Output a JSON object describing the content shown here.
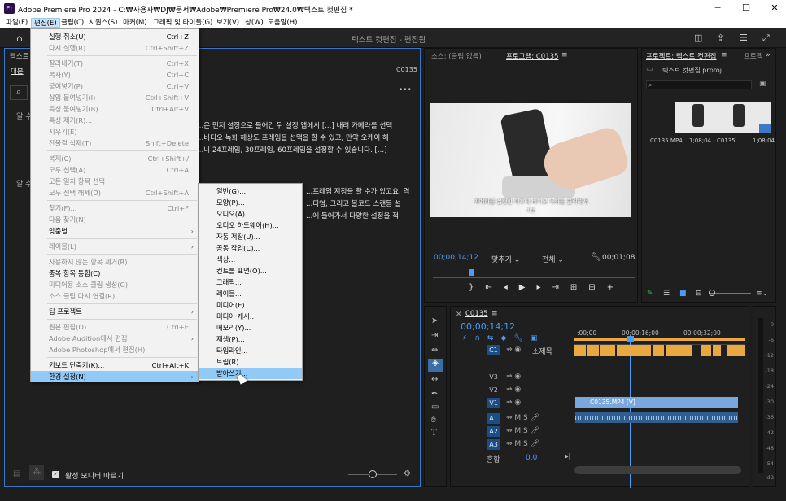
{
  "window": {
    "title": "Adobe Premiere Pro 2024 - C:₩사용자₩DJ₩문서₩Adobe₩Premiere Pro₩24.0₩텍스트 컷편집 *",
    "icon": "Pr",
    "minimize": "─",
    "maximize": "☐",
    "close": "✕"
  },
  "menubar": [
    "파일(F)",
    "편집(E)",
    "클립(C)",
    "시퀀스(S)",
    "마커(M)",
    "그래픽 및 타이틀(G)",
    "보기(V)",
    "창(W)",
    "도움말(H)"
  ],
  "toolbar": {
    "center_title": "텍스트 컷편집 - 편집됨"
  },
  "left_panel": {
    "tab": "텍스트",
    "subtab": "대본",
    "sequence": "C0135",
    "search_icon": "⌕",
    "more": "•••",
    "paragraphs": [
      "...은 먼저 설정으로 들어간 뒤 설정 앱에서 [...] 내려 카메라를 선택",
      "...비디오 녹화 해상도 프레임을 선택을 할 수 있고, 만약 오케이 해",
      "...니 24프레임, 30프레임, 60프레임을 설정할 수 있습니다. [...]",
      "...프레임 지정을 할 수가 있고요. 격",
      "...디엄, 그리고 볼코드 스캔등 설",
      "...에 들어가서 다양한 설정을 적"
    ],
    "speaker1": "알 수",
    "speaker2": "알 수",
    "footer_checkbox": "활성 모니터 따르기"
  },
  "source": {
    "tab1": "소스: (클립 없음)",
    "tab2": "프로그램: C0135",
    "menu": "≡",
    "subtitle": "카메라를 실행한 이후에 비디오 녹화를 클릭해서",
    "subtitle2": "기본",
    "timecode": "00;00;14;12",
    "fit": "맞추기",
    "quality": "전체",
    "duration": "00;01;08"
  },
  "project": {
    "tab1": "프로젝트: 텍스트 컷편집",
    "tab2": "프로젝",
    "menu": "≡",
    "more": "»",
    "file": "텍스트 컷편집.prproj",
    "items": [
      {
        "name": "C0135.MP4",
        "dur": "1;08;04"
      },
      {
        "name": "C0135",
        "dur": "1;08;04"
      }
    ]
  },
  "timeline": {
    "seq": "C0135",
    "menu": "≡",
    "timecode": "00;00;14;12",
    "ruler": [
      ":00;00",
      "00;00;16;00",
      "00;00;32;00"
    ],
    "caption_track": "C1",
    "caption_label": "소제목",
    "v_tracks": [
      "V3",
      "V2",
      "V1"
    ],
    "a_tracks": [
      "A1",
      "A2",
      "A3"
    ],
    "mix_label": "혼합",
    "mix_value": "0.0",
    "clip_label": "C0135.MP4 [V]"
  },
  "meter": {
    "ticks": [
      "0",
      "-6",
      "-12",
      "-18",
      "-24",
      "-30",
      "-36",
      "-42",
      "-48",
      "-54",
      "dB"
    ]
  },
  "edit_menu": [
    {
      "l": "실행 취소(U)",
      "s": "Ctrl+Z",
      "d": false
    },
    {
      "l": "다시 실행(R)",
      "s": "Ctrl+Shift+Z",
      "d": true
    },
    {
      "sep": true
    },
    {
      "l": "잘라내기(T)",
      "s": "Ctrl+X",
      "d": true
    },
    {
      "l": "복사(Y)",
      "s": "Ctrl+C",
      "d": true
    },
    {
      "l": "붙여넣기(P)",
      "s": "Ctrl+V",
      "d": true
    },
    {
      "l": "삽입 붙여넣기(I)",
      "s": "Ctrl+Shift+V",
      "d": true
    },
    {
      "l": "특성 붙여넣기(B)...",
      "s": "Ctrl+Alt+V",
      "d": true
    },
    {
      "l": "특성 제거(R)...",
      "s": "",
      "d": true
    },
    {
      "l": "지우기(E)",
      "s": "",
      "d": true
    },
    {
      "l": "잔물결 삭제(T)",
      "s": "Shift+Delete",
      "d": true
    },
    {
      "sep": true
    },
    {
      "l": "복제(C)",
      "s": "Ctrl+Shift+/",
      "d": true
    },
    {
      "l": "모두 선택(A)",
      "s": "Ctrl+A",
      "d": true
    },
    {
      "l": "모든 일치 항목 선택",
      "s": "",
      "d": true
    },
    {
      "l": "모두 선택 해제(D)",
      "s": "Ctrl+Shift+A",
      "d": true
    },
    {
      "sep": true
    },
    {
      "l": "찾기(F)...",
      "s": "Ctrl+F",
      "d": true
    },
    {
      "l": "다음 찾기(N)",
      "s": "",
      "d": true
    },
    {
      "l": "맞춤법",
      "s": "",
      "d": false,
      "arrow": true
    },
    {
      "sep": true
    },
    {
      "l": "레이블(L)",
      "s": "",
      "d": true,
      "arrow": true
    },
    {
      "sep": true
    },
    {
      "l": "사용하지 않는 항목 제거(R)",
      "s": "",
      "d": true
    },
    {
      "l": "중복 항목 통합(C)",
      "s": "",
      "d": false
    },
    {
      "l": "미디어용 소스 클립 생성(G)",
      "s": "",
      "d": true
    },
    {
      "l": "소스 클립 다시 연결(R)...",
      "s": "",
      "d": true
    },
    {
      "sep": true
    },
    {
      "l": "팀 프로젝트",
      "s": "",
      "d": false,
      "arrow": true
    },
    {
      "sep": true
    },
    {
      "l": "원본 편집(O)",
      "s": "Ctrl+E",
      "d": true
    },
    {
      "l": "Adobe Audition에서 편집",
      "s": "",
      "d": true,
      "arrow": true
    },
    {
      "l": "Adobe Photoshop에서 편집(H)",
      "s": "",
      "d": true
    },
    {
      "sep": true
    },
    {
      "l": "키보드 단축키(K)...",
      "s": "Ctrl+Alt+K",
      "d": false
    },
    {
      "l": "환경 설정(N)",
      "s": "",
      "d": false,
      "arrow": true,
      "hi": true
    }
  ],
  "pref_menu": [
    "일반(G)...",
    "모양(P)...",
    "오디오(A)...",
    "오디오 하드웨어(H)...",
    "자동 저장(U)...",
    "공동 작업(C)...",
    "색상...",
    "컨트롤 표면(O)...",
    "그래픽...",
    "레이블...",
    "미디어(E)...",
    "미디어 캐시...",
    "메모리(Y)...",
    "재생(P)...",
    "타임라인...",
    "트림(R)...",
    "받아쓰기..."
  ]
}
